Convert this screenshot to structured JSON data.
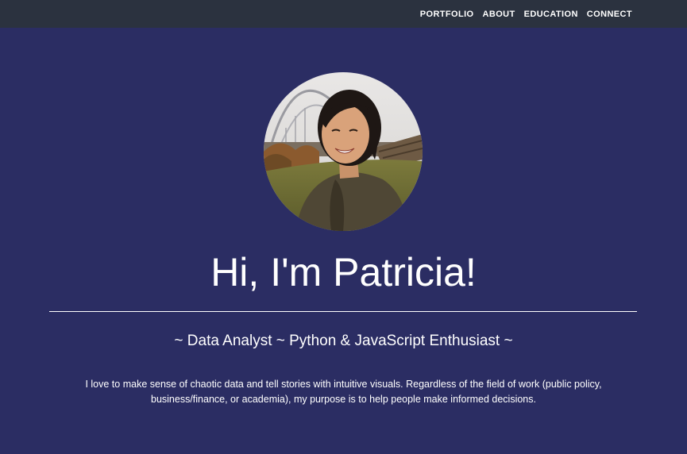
{
  "nav": {
    "items": [
      {
        "label": "PORTFOLIO"
      },
      {
        "label": "ABOUT"
      },
      {
        "label": "EDUCATION"
      },
      {
        "label": "CONNECT"
      }
    ]
  },
  "hero": {
    "title": "Hi, I'm Patricia!",
    "subtitle": "~ Data Analyst ~ Python & JavaScript Enthusiast ~",
    "bio": "I love to make sense of chaotic data and tell stories with intuitive visuals. Regardless of the field of work (public policy, business/finance, or academia), my purpose is to help people make informed decisions."
  },
  "colors": {
    "background": "#2b2d63",
    "navbar": "#2b323f",
    "text": "#ffffff"
  }
}
